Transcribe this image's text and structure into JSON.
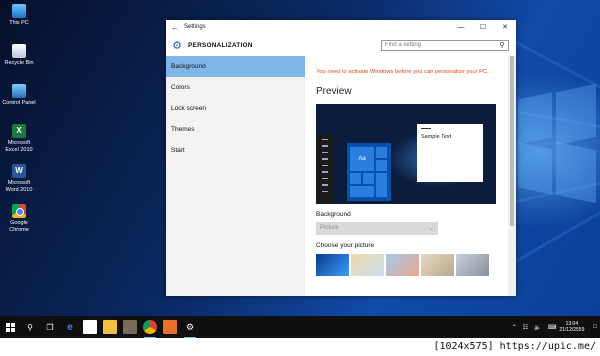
{
  "desktop": {
    "icons": [
      {
        "label": "This PC",
        "icon": "this-pc-icon"
      },
      {
        "label": "Recycle Bin",
        "icon": "recycle-bin-icon"
      },
      {
        "label": "Control Panel",
        "icon": "control-panel-icon"
      },
      {
        "label": "Microsoft Excel 2010",
        "icon": "excel-icon",
        "glyph": "X"
      },
      {
        "label": "Microsoft Word 2010",
        "icon": "word-icon",
        "glyph": "W"
      },
      {
        "label": "Google Chrome",
        "icon": "chrome-icon"
      }
    ]
  },
  "window": {
    "title": "Settings",
    "page_title": "PERSONALIZATION",
    "search_placeholder": "Find a setting",
    "nav": [
      "Background",
      "Colors",
      "Lock screen",
      "Themes",
      "Start"
    ],
    "active_nav": "Background",
    "content": {
      "warning": "You need to activate Windows before you can personalize your PC.",
      "preview_heading": "Preview",
      "preview_tile_label": "Aa",
      "preview_sample_text": "Sample Text",
      "background_label": "Background",
      "background_value": "Picture",
      "choose_picture_label": "Choose your picture"
    }
  },
  "taskbar": {
    "clock_time": "13:04",
    "clock_date": "21/12/2559"
  },
  "footer": {
    "stamp": "[1024x575] https://upic.me/"
  },
  "colors": {
    "accent": "#7fb6e8",
    "warning": "#e04a14",
    "taskbar": "#101010",
    "gear": "#1f5fbd"
  }
}
